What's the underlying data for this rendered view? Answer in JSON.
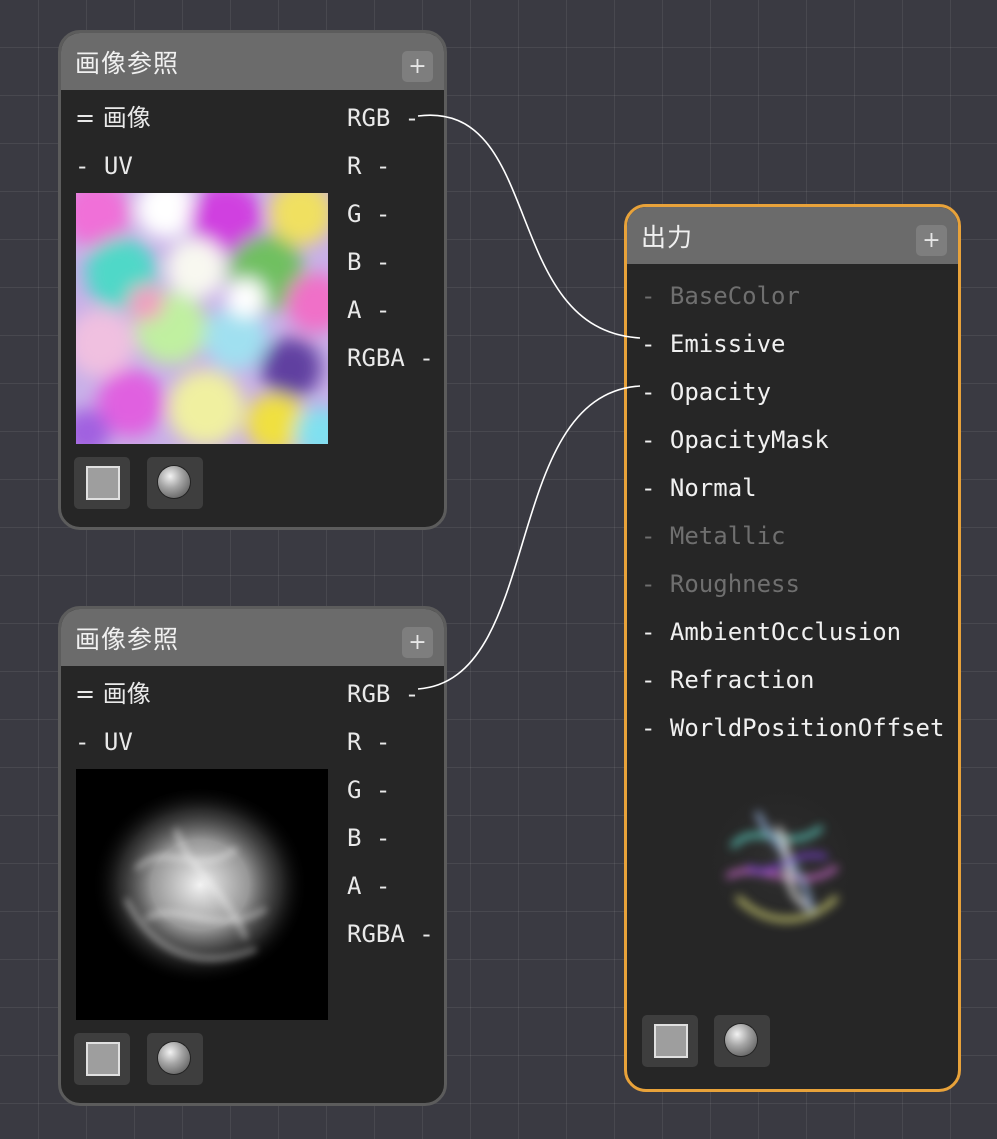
{
  "nodes": [
    {
      "title": "画像参照",
      "add_label": "+",
      "input_image": "= 画像",
      "input_uv": "- UV",
      "outputs": [
        "RGB -",
        "R -",
        "G -",
        "B -",
        "A -",
        "RGBA -"
      ],
      "preview": "color-noise-texture"
    },
    {
      "title": "画像参照",
      "add_label": "+",
      "input_image": "= 画像",
      "input_uv": "- UV",
      "outputs": [
        "RGB -",
        "R -",
        "G -",
        "B -",
        "A -",
        "RGBA -"
      ],
      "preview": "white-smoke-on-black-texture"
    }
  ],
  "output_node": {
    "title": "出力",
    "add_label": "+",
    "slots": [
      {
        "label": "- BaseColor",
        "connected": false,
        "enabled": false
      },
      {
        "label": "- Emissive",
        "connected": true,
        "enabled": true
      },
      {
        "label": "- Opacity",
        "connected": true,
        "enabled": true
      },
      {
        "label": "- OpacityMask",
        "connected": false,
        "enabled": true
      },
      {
        "label": "- Normal",
        "connected": false,
        "enabled": true
      },
      {
        "label": "- Metallic",
        "connected": false,
        "enabled": false
      },
      {
        "label": "- Roughness",
        "connected": false,
        "enabled": false
      },
      {
        "label": "- AmbientOcclusion",
        "connected": false,
        "enabled": true
      },
      {
        "label": "- Refraction",
        "connected": false,
        "enabled": true
      },
      {
        "label": "- WorldPositionOffset",
        "connected": false,
        "enabled": true
      }
    ],
    "preview": "colored-smoke-result"
  },
  "icons": {
    "plane_preview": "square-icon",
    "sphere_preview": "sphere-icon"
  },
  "colors": {
    "canvas": "#3a3a42",
    "node_body": "#262626",
    "node_header": "#6b6b6b",
    "output_border": "#e8a23a",
    "wire": "#ffffff",
    "disabled_text": "#6f6f6f"
  }
}
